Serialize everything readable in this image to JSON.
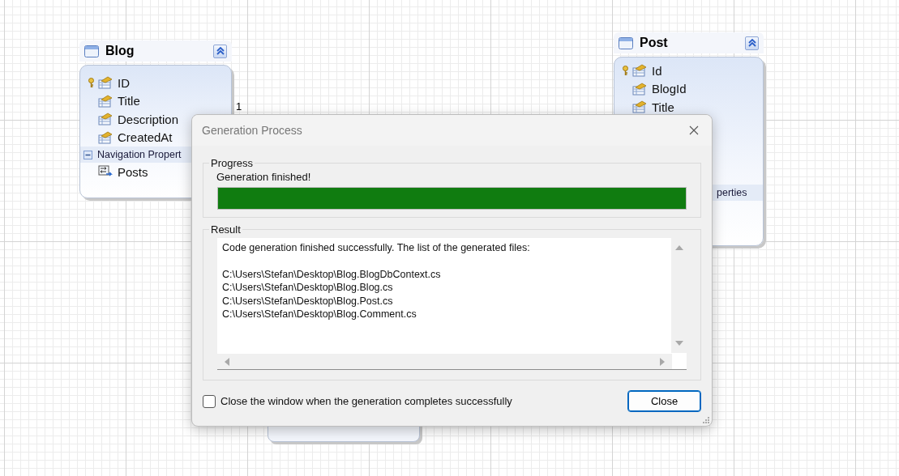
{
  "diagram": {
    "entities": [
      {
        "name": "Blog",
        "properties": [
          {
            "name": "ID",
            "key": true
          },
          {
            "name": "Title",
            "key": false
          },
          {
            "name": "Description",
            "key": false
          },
          {
            "name": "CreatedAt",
            "key": false
          }
        ],
        "navigation": {
          "label": "Navigation Propert",
          "items": [
            "Posts"
          ]
        }
      },
      {
        "name": "Post",
        "properties": [
          {
            "name": "Id",
            "key": true
          },
          {
            "name": "BlogId",
            "key": false
          },
          {
            "name": "Title",
            "key": false
          }
        ],
        "navigation": {
          "label": "perties"
        }
      }
    ],
    "association_label": "1"
  },
  "dialog": {
    "title": "Generation Process",
    "progress": {
      "group_label": "Progress",
      "status": "Generation finished!",
      "level": 1
    },
    "result": {
      "group_label": "Result",
      "message": "Code generation finished successfully. The list of the generated files:",
      "files": [
        "C:\\Users\\Stefan\\Desktop\\Blog.BlogDbContext.cs",
        "C:\\Users\\Stefan\\Desktop\\Blog.Blog.cs",
        "C:\\Users\\Stefan\\Desktop\\Blog.Post.cs",
        "C:\\Users\\Stefan\\Desktop\\Blog.Comment.cs"
      ]
    },
    "close_option": {
      "label": "Close the window when the generation completes successfully",
      "checked": false
    },
    "buttons": [
      "Close"
    ]
  }
}
